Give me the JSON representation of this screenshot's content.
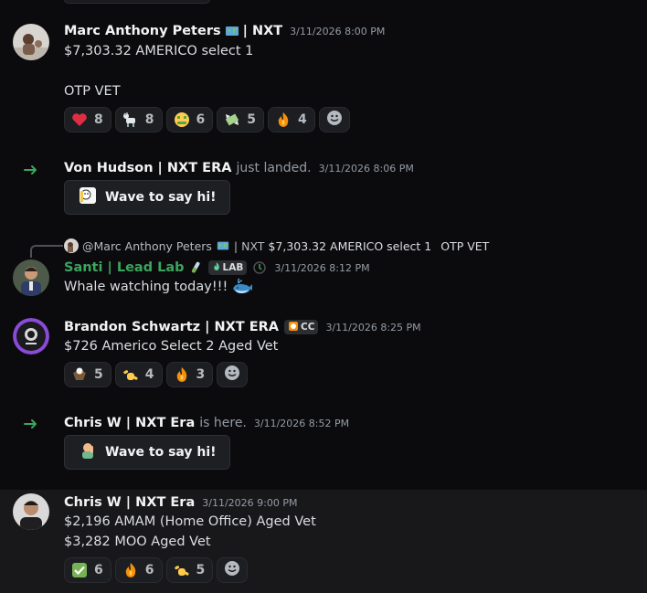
{
  "messages": [
    {
      "author": "Marc Anthony Peters",
      "author_suffix": "| NXT",
      "timestamp": "3/11/2026 8:00 PM",
      "lines": [
        "$7,303.32 AMERICO select 1",
        "OTP VET"
      ],
      "reactions": [
        {
          "emoji": "heart",
          "count": "8"
        },
        {
          "emoji": "goat",
          "count": "8"
        },
        {
          "emoji": "money-mouth-face",
          "count": "6"
        },
        {
          "emoji": "money-with-wings",
          "count": "5"
        },
        {
          "emoji": "fire",
          "count": "4"
        }
      ]
    },
    {
      "type": "join",
      "author": "Von Hudson | NXT ERA",
      "system_text": "just landed.",
      "timestamp": "3/11/2026 8:06 PM",
      "wave_label": "Wave to say hi!"
    },
    {
      "reply": {
        "author": "@Marc Anthony Peters",
        "author_suffix": "| NXT",
        "text": "$7,303.32 AMERICO select 1",
        "text2": "OTP VET"
      },
      "author": "Santi | Lead Lab",
      "author_color": "#3ba55d",
      "tag": "LAB",
      "timestamp": "3/11/2026 8:12 PM",
      "lines": [
        "Whale watching today!!!"
      ]
    },
    {
      "author": "Brandon Schwartz | NXT ERA",
      "tag": "CC",
      "timestamp": "3/11/2026 8:25 PM",
      "lines": [
        "$726 Americo Select 2 Aged Vet"
      ],
      "reactions": [
        {
          "emoji": "eagle",
          "count": "5"
        },
        {
          "emoji": "call-me-hand",
          "count": "4"
        },
        {
          "emoji": "fire",
          "count": "3"
        }
      ]
    },
    {
      "type": "join",
      "author": "Chris W | NXT Era",
      "system_text": "is here.",
      "timestamp": "3/11/2026 8:52 PM",
      "wave_label": "Wave to say hi!"
    },
    {
      "author": "Chris W | NXT Era",
      "timestamp": "3/11/2026 9:00 PM",
      "lines": [
        "$2,196 AMAM (Home Office) Aged Vet",
        "$3,282 MOO Aged Vet"
      ],
      "reactions": [
        {
          "emoji": "check-mark-button",
          "count": "6"
        },
        {
          "emoji": "fire",
          "count": "6"
        },
        {
          "emoji": "call-me-hand",
          "count": "5"
        }
      ]
    }
  ],
  "colors": {
    "background": "#0b0b0d",
    "hover_background": "#18181b",
    "join_arrow": "#3ba55d",
    "santi_name": "#3ba55d"
  }
}
